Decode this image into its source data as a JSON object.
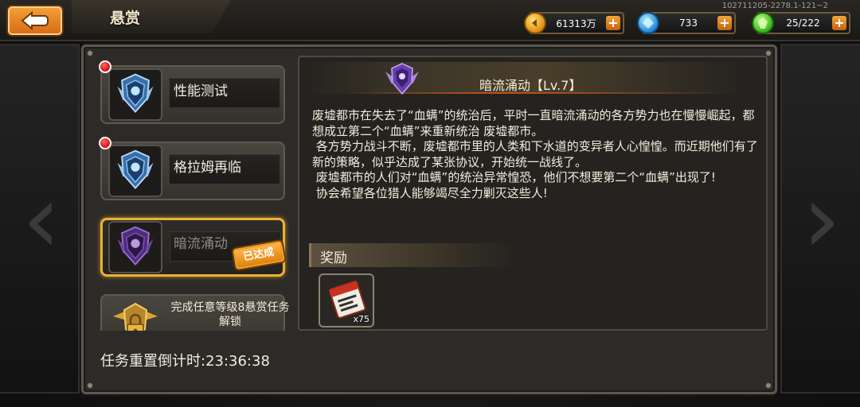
{
  "header": {
    "title": "悬赏",
    "build_id": "102711205-2278.1-121~2"
  },
  "currencies": {
    "gold": "61313万",
    "gems": "733",
    "energy": "25/222"
  },
  "quests": [
    {
      "label": "性能测试",
      "has_notification": true
    },
    {
      "label": "格拉姆再临",
      "has_notification": true
    },
    {
      "label": "暗流涌动",
      "selected": true,
      "stamp": "已达成"
    },
    {
      "label": "完成任意等级8悬赏任务解锁",
      "locked": true
    }
  ],
  "reset_timer": "任务重置倒计时:23:36:38",
  "detail": {
    "title": "暗流涌动【Lv.7】",
    "description": "废墟都市在失去了“血螨”的统治后，平时一直暗流涌动的各方势力也在慢慢崛起，都想成立第二个“血螨”来重新统治 废墟都市。\n 各方势力战斗不断，废墟都市里的人类和下水道的变异者人心惶惶。而近期他们有了新的策略，似乎达成了某张协议，开始统一战线了。\n 废墟都市的人们对“血螨”的统治异常惶恐，他们不想要第二个“血螨”出现了!\n 协会希望各位猎人能够竭尽全力剿灭这些人!",
    "reward_title": "奖励",
    "reward_item": {
      "icon": "ticket-scroll-icon",
      "quantity": "x75"
    }
  }
}
